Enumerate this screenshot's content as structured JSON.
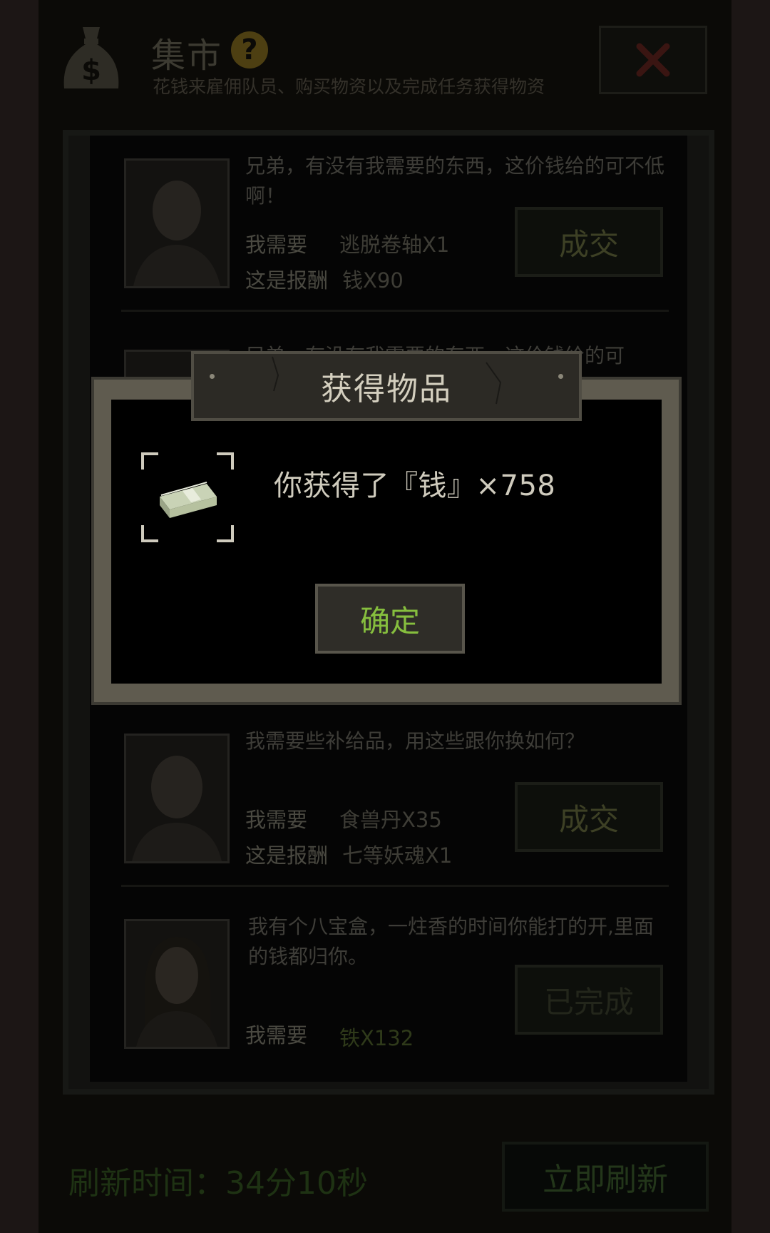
{
  "header": {
    "title": "集市",
    "subtitle": "花钱来雇佣队员、购买物资以及完成任务获得物资",
    "help_icon": "?",
    "icons": [
      "money-bag-icon",
      "help-icon",
      "close-icon"
    ]
  },
  "quests": [
    {
      "text": "兄弟，有没有我需要的东西，这价钱给的可不低啊！",
      "need_label": "我需要",
      "need_value": "逃脱卷轴X1",
      "reward_label": "这是报酬",
      "reward_value": "钱X90",
      "button": "成交"
    },
    {
      "text": "兄弟，有没有我需要的东西，这价钱给的可"
    },
    {
      "text": "我需要些补给品，用这些跟你换如何？",
      "need_label": "我需要",
      "need_value": "食兽丹X35",
      "reward_label": "这是报酬",
      "reward_value": "七等妖魂X1",
      "button": "成交"
    },
    {
      "text": "我有个八宝盒，一炷香的时间你能打的开,里面的钱都归你。",
      "need_label": "我需要",
      "need_value": "铁X132",
      "button": "已完成"
    }
  ],
  "footer": {
    "refresh_label": "刷新时间：",
    "refresh_time": "34分10秒",
    "refresh_button": "立即刷新"
  },
  "modal": {
    "title": "获得物品",
    "message": "你获得了『钱』×758",
    "confirm": "确定",
    "item_icon": "cash-stack-icon"
  },
  "colors": {
    "confirm_text": "#86be3e",
    "modal_border": "#5f5b4f",
    "dim_overlay": "#0b0a07"
  }
}
